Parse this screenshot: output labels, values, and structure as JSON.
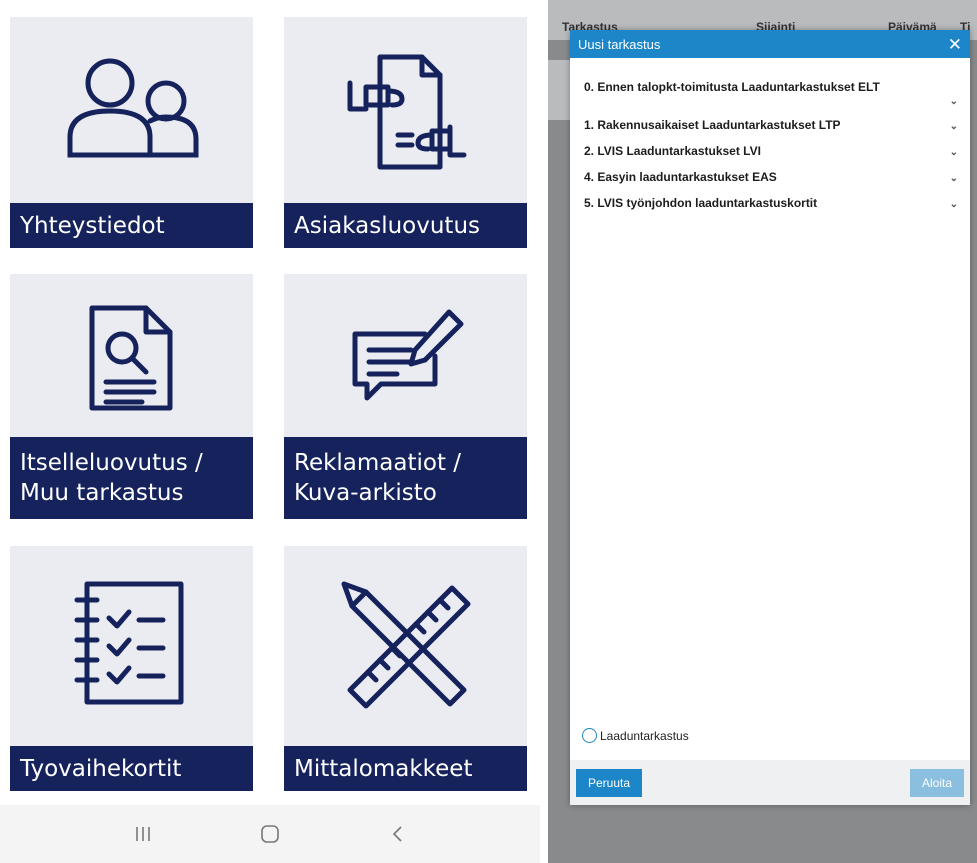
{
  "tiles": [
    {
      "id": "contacts",
      "icon": "people-icon",
      "label_lines": [
        "Yhteystiedot"
      ]
    },
    {
      "id": "customer_handover",
      "icon": "document-handover-icon",
      "label_lines": [
        "Asiakasluovutus"
      ]
    },
    {
      "id": "self_handover",
      "icon": "document-search-icon",
      "label_lines": [
        "Itselleluovutus /",
        "Muu tarkastus"
      ]
    },
    {
      "id": "complaints",
      "icon": "message-edit-icon",
      "label_lines": [
        "Reklamaatiot /",
        "Kuva-arkisto"
      ]
    },
    {
      "id": "work_phase_cards",
      "icon": "checklist-icon",
      "label_lines": [
        "Tyovaihekortit"
      ]
    },
    {
      "id": "measurement_forms",
      "icon": "ruler-pencil-icon",
      "label_lines": [
        "Mittalomakkeet"
      ]
    }
  ],
  "navbar": {
    "recent_icon": "recent-apps-icon",
    "home_icon": "home-icon",
    "back_icon": "back-icon"
  },
  "background_table": {
    "headers": [
      "Tarkastus",
      "Sijainti",
      "Päivämä",
      "Ti"
    ]
  },
  "modal": {
    "title": "Uusi tarkastus",
    "close_glyph": "✕",
    "items": [
      "0. Ennen talopkt-toimitusta Laaduntarkastukset ELT",
      "1. Rakennusaikaiset Laaduntarkastukset LTP",
      "2. LVIS Laaduntarkastukset LVI",
      "4. Easyin laaduntarkastukset EAS",
      "5. LVIS työnjohdon laaduntarkastuskortit"
    ],
    "radio_label": "Laaduntarkastus",
    "cancel_label": "Peruuta",
    "start_label": "Aloita"
  },
  "colors": {
    "tile_label_bg": "#15225c",
    "tile_bg": "#eaecf1",
    "icon_stroke": "#15225c",
    "modal_accent": "#1d86c8"
  }
}
